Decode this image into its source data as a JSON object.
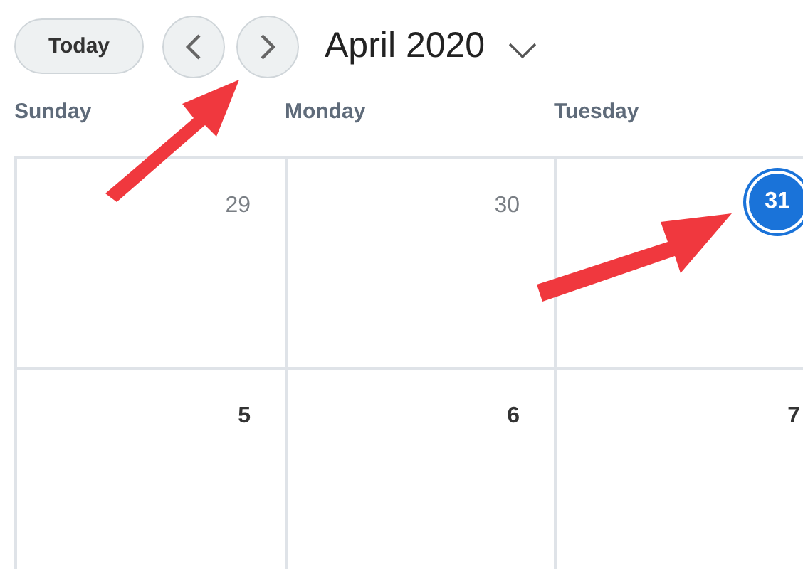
{
  "toolbar": {
    "today_button": "Today",
    "title": "April 2020"
  },
  "weekdays": [
    "Sunday",
    "Monday",
    "Tuesday"
  ],
  "weeks": [
    [
      {
        "day": "29",
        "in_month": false,
        "today": false
      },
      {
        "day": "30",
        "in_month": false,
        "today": false
      },
      {
        "day": "31",
        "today": true
      }
    ],
    [
      {
        "day": "5",
        "in_month": true,
        "today": false
      },
      {
        "day": "6",
        "in_month": true,
        "today": false
      },
      {
        "day": "7",
        "in_month": true,
        "today": false
      }
    ]
  ]
}
